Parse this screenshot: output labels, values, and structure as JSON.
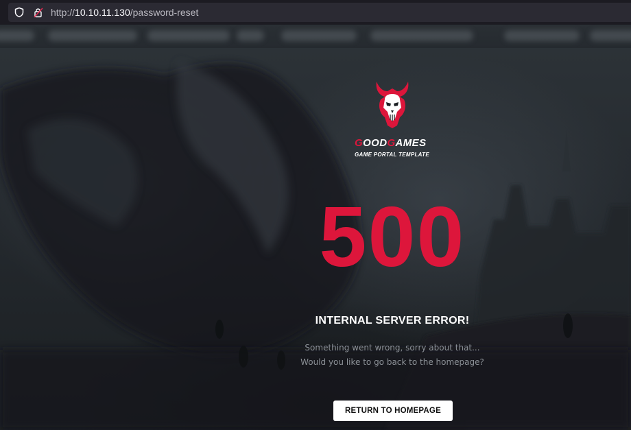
{
  "browser": {
    "url_protocol": "http://",
    "url_host": "10.10.11.130",
    "url_path": "/password-reset"
  },
  "brand": {
    "name_part1_accent": "G",
    "name_part1": "OOD",
    "name_part2_accent": "G",
    "name_part2": "AMES",
    "tagline": "GAME PORTAL TEMPLATE"
  },
  "error": {
    "code": "500",
    "title": "INTERNAL SERVER ERROR!",
    "message_line1": "Something went wrong, sorry about that...",
    "message_line2": "Would you like to go back to the homepage?",
    "button_label": "RETURN TO HOMEPAGE"
  },
  "colors": {
    "accent": "#dd163b",
    "background": "#1c2024",
    "urlbar": "#2b2a33"
  }
}
